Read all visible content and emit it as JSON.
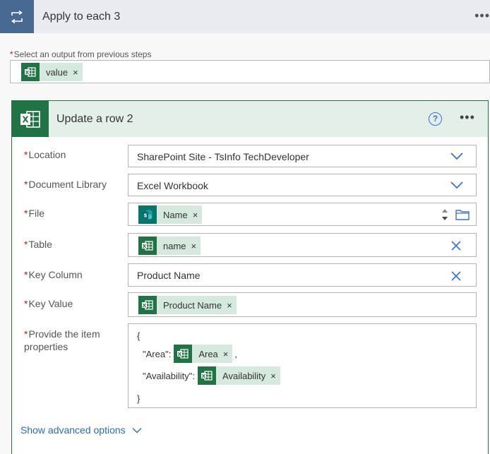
{
  "loop": {
    "title": "Apply to each 3"
  },
  "select_output": {
    "label": "Select an output from previous steps",
    "token": "value"
  },
  "action": {
    "title": "Update a row 2",
    "help": "?",
    "fields": {
      "location": {
        "label": "Location",
        "value": "SharePoint Site - TsInfo TechDeveloper"
      },
      "library": {
        "label": "Document Library",
        "value": "Excel Workbook"
      },
      "file": {
        "label": "File",
        "token": "Name"
      },
      "table": {
        "label": "Table",
        "token": "name"
      },
      "key_column": {
        "label": "Key Column",
        "value": "Product Name"
      },
      "key_value": {
        "label": "Key Value",
        "token": "Product Name"
      },
      "item_properties": {
        "label": "Provide the item properties",
        "open_brace": "{",
        "close_brace": "}",
        "area_key": "\"Area\":",
        "area_token": "Area",
        "availability_key": "\"Availability\":",
        "availability_token": "Availability",
        "comma": ","
      }
    },
    "advanced": "Show advanced options"
  },
  "token_remove": "×",
  "required_mark": "*",
  "colors": {
    "excel": "#217346",
    "sharepoint": "#077568",
    "loop": "#486991",
    "token_bg": "#d5e9df",
    "link": "#2a6bb5"
  },
  "icons": {
    "loop": "loop-icon",
    "excel": "excel-icon",
    "sharepoint": "sharepoint-icon",
    "help": "help-icon",
    "chevron": "chevron-down-icon",
    "clear": "close-icon",
    "folder": "folder-icon"
  }
}
